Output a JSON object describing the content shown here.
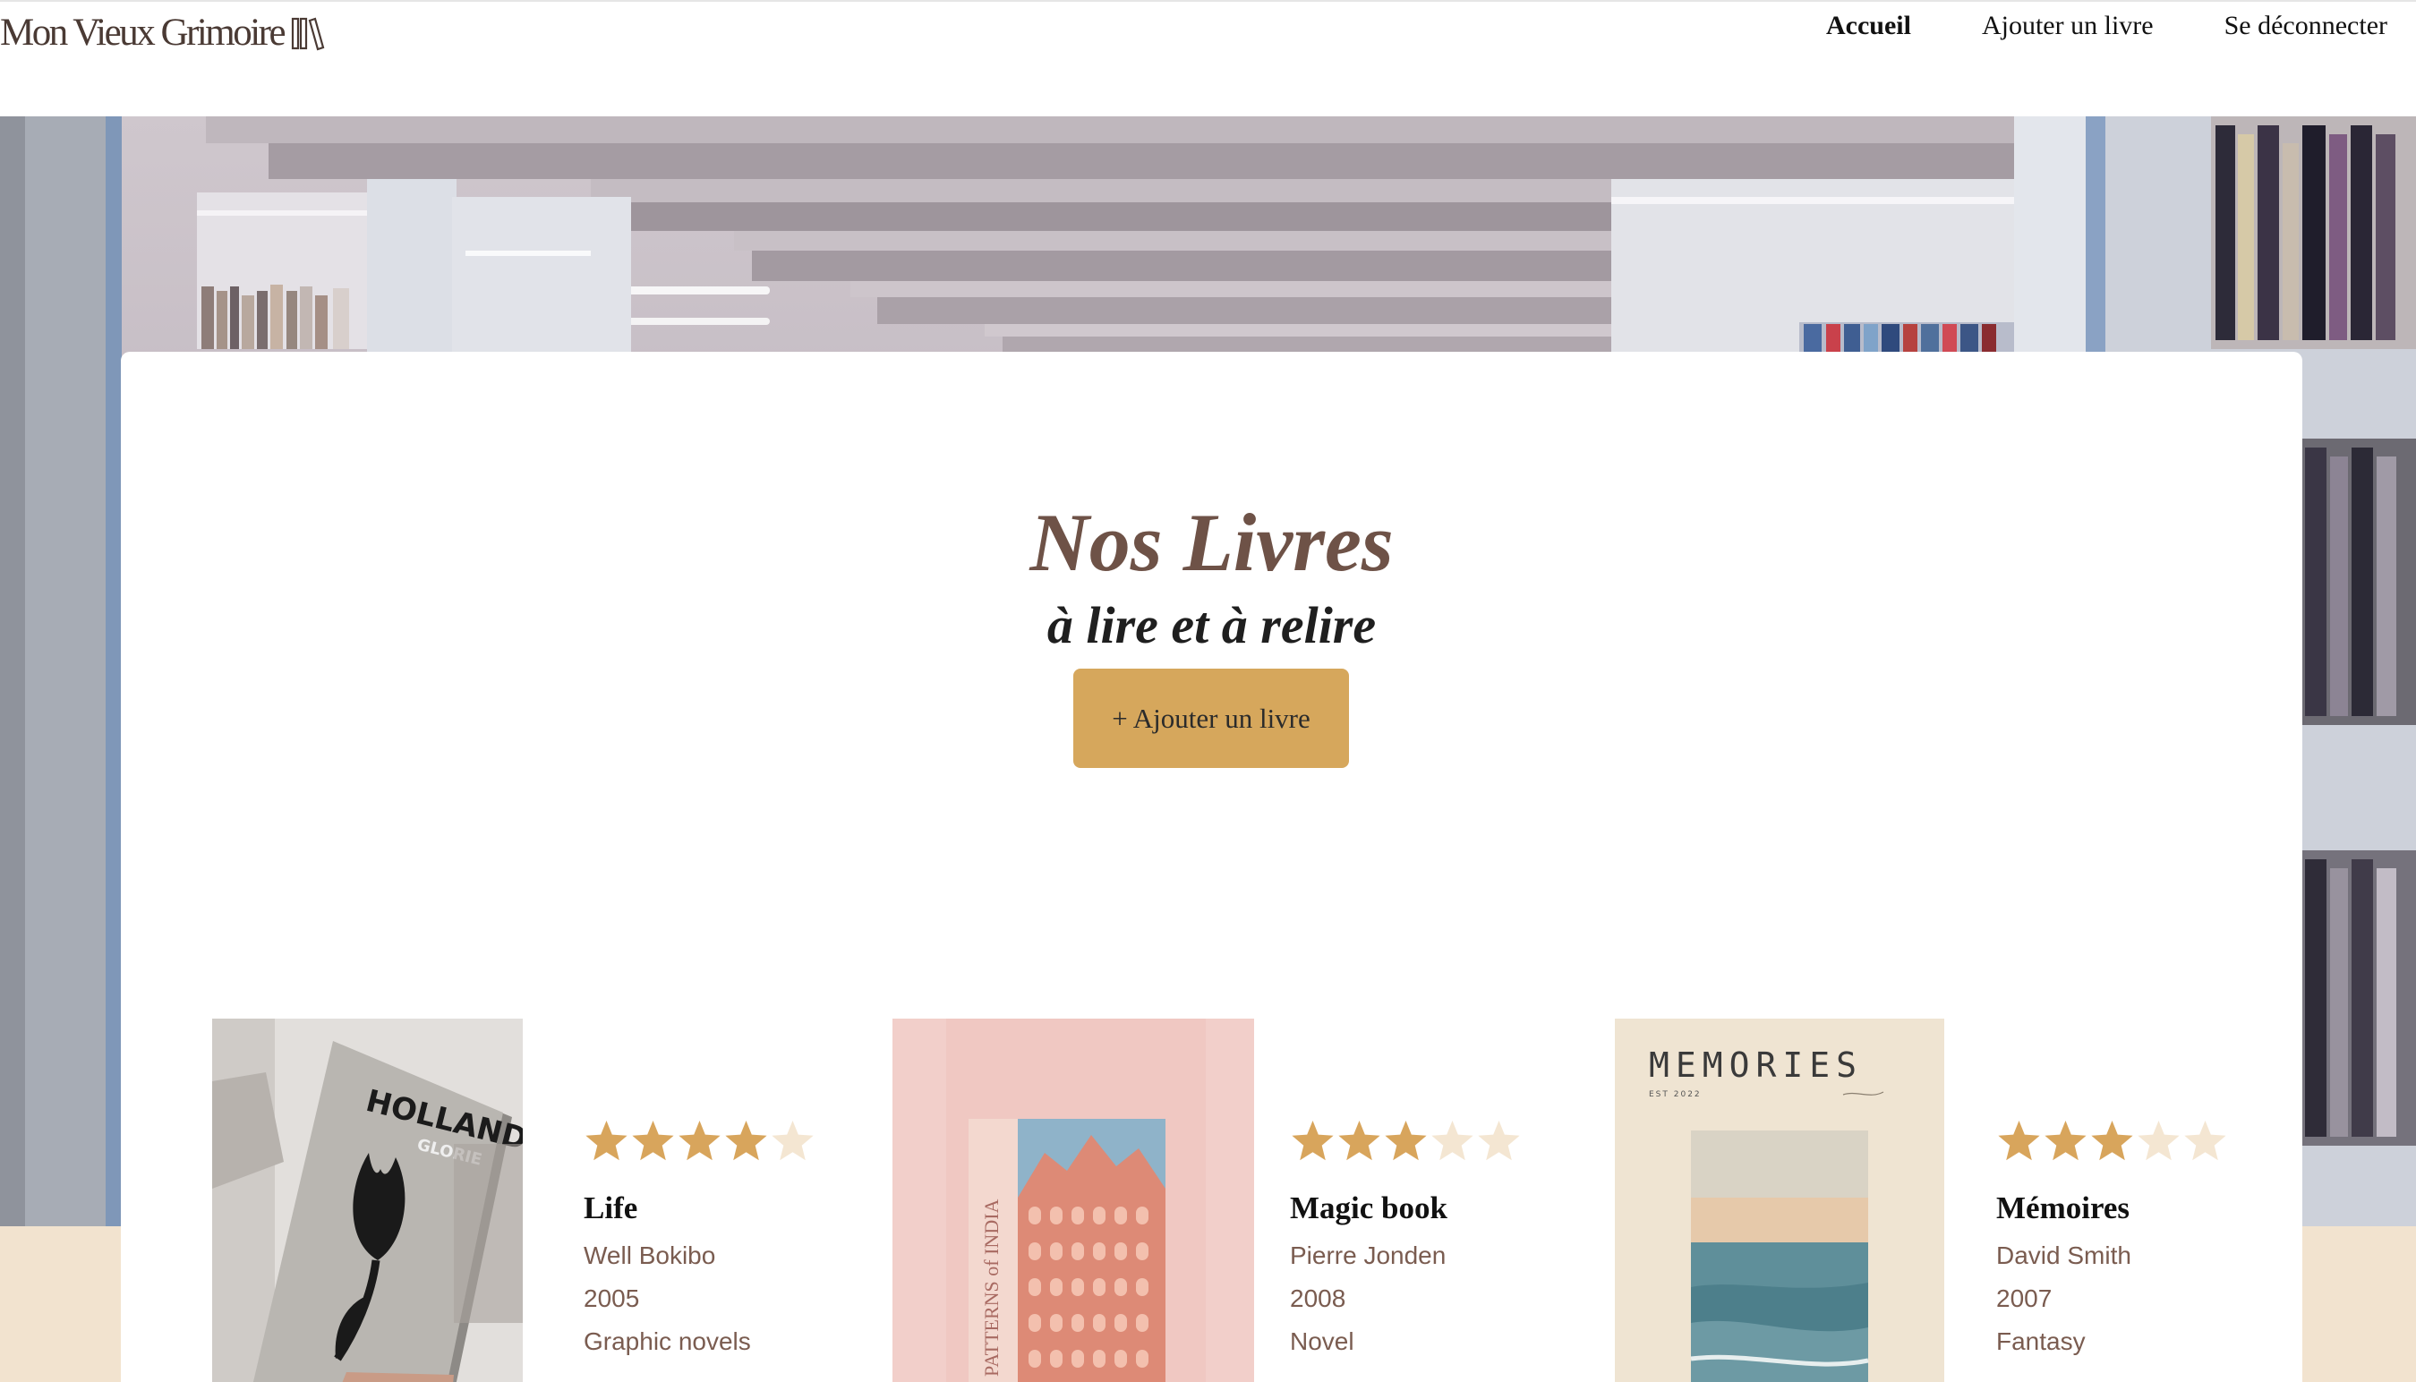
{
  "header": {
    "logo_text": "Mon Vieux Grimoire",
    "nav": [
      {
        "label": "Accueil",
        "active": true
      },
      {
        "label": "Ajouter un livre",
        "active": false
      },
      {
        "label": "Se déconnecter",
        "active": false
      }
    ]
  },
  "main": {
    "title": "Nos Livres",
    "subtitle": "à lire et à relire",
    "add_button": "+ Ajouter un livre"
  },
  "books": [
    {
      "title": "Life",
      "author": "Well Bokibo",
      "year": "2005",
      "genre": "Graphic novels",
      "rating": 4,
      "max_rating": 5,
      "cover_text": [
        "HOLLANDS",
        "GLORIE"
      ]
    },
    {
      "title": "Magic book",
      "author": "Pierre Jonden",
      "year": "2008",
      "genre": "Novel",
      "rating": 3,
      "max_rating": 5,
      "cover_text": [
        "PATTERNS of INDIA"
      ]
    },
    {
      "title": "Mémoires",
      "author": "David Smith",
      "year": "2007",
      "genre": "Fantasy",
      "rating": 3,
      "max_rating": 5,
      "cover_text": [
        "MEMORIES",
        "EST 2022"
      ]
    }
  ],
  "colors": {
    "accent": "#d6a75c",
    "star_filled": "#d8a55c",
    "star_empty": "#f4e6d2",
    "title_brown": "#6e5247",
    "meta_brown": "#7a5c50",
    "cream": "#f2e3cf"
  }
}
